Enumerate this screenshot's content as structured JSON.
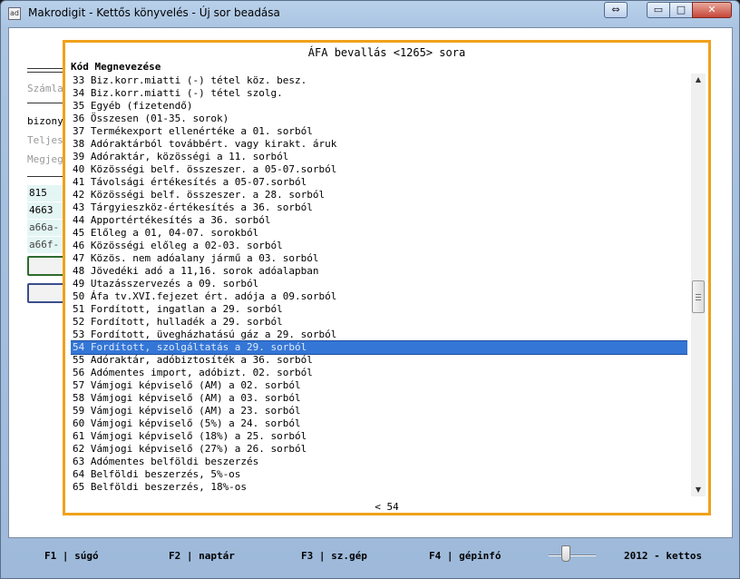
{
  "window": {
    "title": "Makrodigit - Kettős könyvelés - Új sor beadása",
    "icon_label": "ad",
    "controls": {
      "resize": "⇔",
      "minimize": "▭",
      "maximize": "□",
      "close": "✕"
    }
  },
  "background_form": {
    "labels": [
      {
        "text": "Számla",
        "style": "grey"
      },
      {
        "text": "bizony",
        "style": "dark"
      },
      {
        "text": "Teljes",
        "style": "grey"
      },
      {
        "text": "Megjeg",
        "style": "grey"
      }
    ],
    "fields": [
      "815",
      "4663",
      "a66a-",
      "a66f-"
    ]
  },
  "dialog": {
    "title": "ÁFA bevallás <1265> sora",
    "column_header": "Kód Megnevezése",
    "rows": [
      {
        "code": "33",
        "name": "Biz.korr.miatti (-) tétel köz. besz."
      },
      {
        "code": "34",
        "name": "Biz.korr.miatti (-) tétel szolg."
      },
      {
        "code": "35",
        "name": "Egyéb (fizetendő)"
      },
      {
        "code": "36",
        "name": "Összesen (01-35. sorok)"
      },
      {
        "code": "37",
        "name": "Termékexport ellenértéke a 01. sorból"
      },
      {
        "code": "38",
        "name": "Adóraktárból továbbért. vagy kirakt. áruk"
      },
      {
        "code": "39",
        "name": "Adóraktár, közösségi a 11. sorból"
      },
      {
        "code": "40",
        "name": "Közösségi belf. összeszer. a 05-07.sorból"
      },
      {
        "code": "41",
        "name": "Távolsági értékesítés a 05-07.sorból"
      },
      {
        "code": "42",
        "name": "Közösségi belf. összeszer. a 28. sorból"
      },
      {
        "code": "43",
        "name": "Tárgyieszköz-értékesítés a 36. sorból"
      },
      {
        "code": "44",
        "name": "Apportértékesítés a 36. sorból"
      },
      {
        "code": "45",
        "name": "Előleg a 01, 04-07. sorokból"
      },
      {
        "code": "46",
        "name": "Közösségi előleg a 02-03. sorból"
      },
      {
        "code": "47",
        "name": "Közös. nem adóalany jármű a 03. sorból"
      },
      {
        "code": "48",
        "name": "Jövedéki adó a 11,16. sorok adóalapban"
      },
      {
        "code": "49",
        "name": "Utazásszervezés a 09. sorból"
      },
      {
        "code": "50",
        "name": "Áfa tv.XVI.fejezet ért. adója a 09.sorból"
      },
      {
        "code": "51",
        "name": "Fordított, ingatlan a 29. sorból"
      },
      {
        "code": "52",
        "name": "Fordított, hulladék a 29. sorból"
      },
      {
        "code": "53",
        "name": "Fordított, üvegházhatású gáz a 29. sorból"
      },
      {
        "code": "54",
        "name": "Fordított, szolgáltatás a 29. sorból",
        "selected": true
      },
      {
        "code": "55",
        "name": "Adóraktár, adóbiztosíték a 36. sorból"
      },
      {
        "code": "56",
        "name": "Adómentes import, adóbizt. 02. sorból"
      },
      {
        "code": "57",
        "name": "Vámjogi képviselő (AM) a 02. sorból"
      },
      {
        "code": "58",
        "name": "Vámjogi képviselő (AM) a 03. sorból"
      },
      {
        "code": "59",
        "name": "Vámjogi képviselő (AM) a 23. sorból"
      },
      {
        "code": "60",
        "name": "Vámjogi képviselő (5%) a 24. sorból"
      },
      {
        "code": "61",
        "name": "Vámjogi képviselő (18%) a 25. sorból"
      },
      {
        "code": "62",
        "name": "Vámjogi képviselő (27%) a 26. sorból"
      },
      {
        "code": "63",
        "name": "Adómentes belföldi beszerzés"
      },
      {
        "code": "64",
        "name": "Belföldi beszerzés, 5%-os"
      },
      {
        "code": "65",
        "name": "Belföldi beszerzés, 18%-os"
      }
    ],
    "position_indicator": "< 54",
    "scrollbar": {
      "up": "▲",
      "down": "▼"
    }
  },
  "statusbar": {
    "f1": "F1 | súgó",
    "f2": "F2 | naptár",
    "f3": "F3 | sz.gép",
    "f4": "F4 | gépinfó",
    "info": "2012 - kettos"
  }
}
